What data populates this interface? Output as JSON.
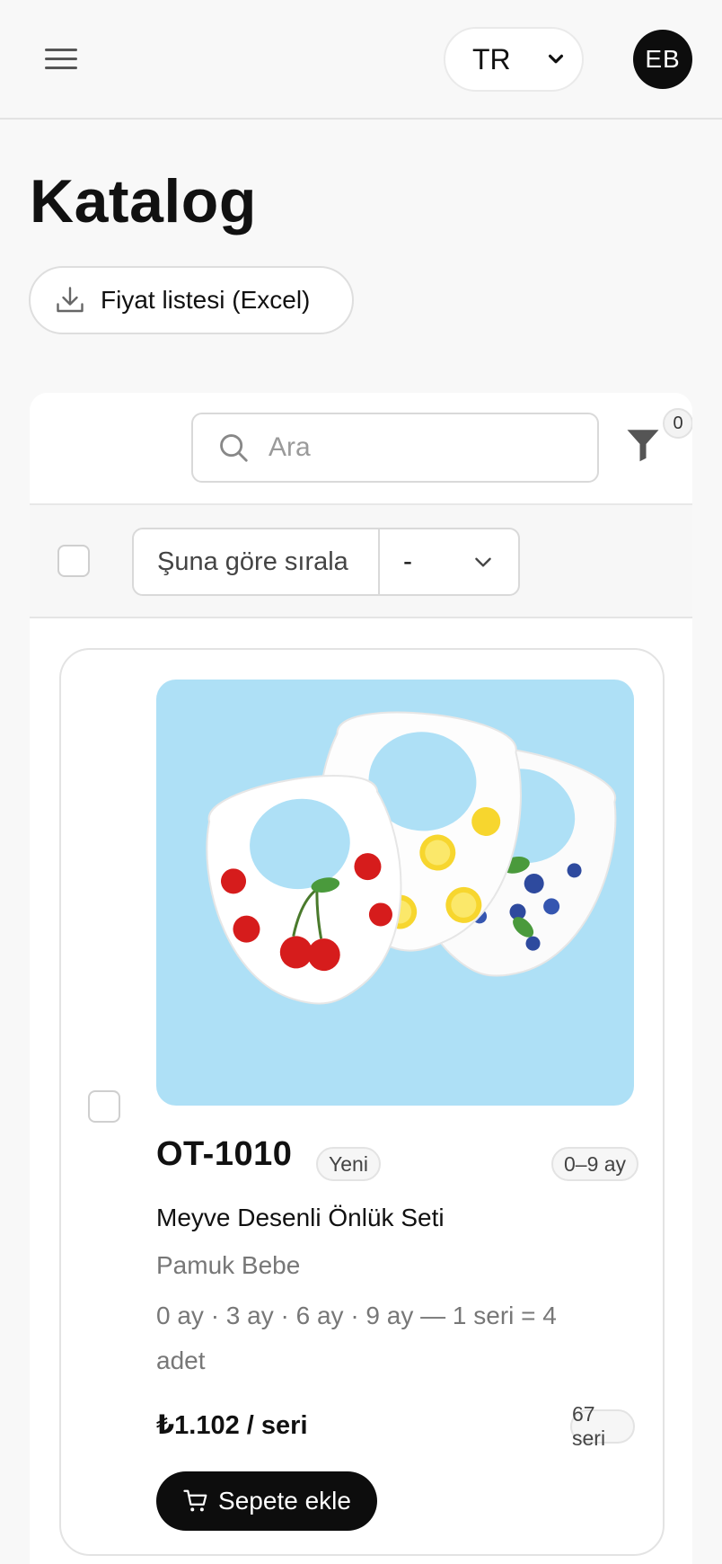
{
  "header": {
    "language": "TR",
    "user_initials": "EB"
  },
  "page": {
    "title": "Katalog",
    "export_button": "Fiyat listesi (Excel)"
  },
  "toolbar": {
    "search_placeholder": "Ara",
    "filter_count": "0",
    "sort_label": "Şuna göre sırala",
    "sort_value": "-"
  },
  "products": [
    {
      "sku": "OT-1010",
      "status_badge": "Yeni",
      "age_range": "0–9 ay",
      "name": "Meyve Desenli Önlük Seti",
      "brand": "Pamuk Bebe",
      "sizes": "0 ay · 3 ay · 6 ay · 9 ay — 1 seri = 4 adet",
      "price": "₺1.102 / seri",
      "stock": "67 seri",
      "add_to_cart": "Sepete ekle"
    }
  ],
  "colors": {
    "accent": "#0d0d0d",
    "image_background": "#aee0f6"
  }
}
